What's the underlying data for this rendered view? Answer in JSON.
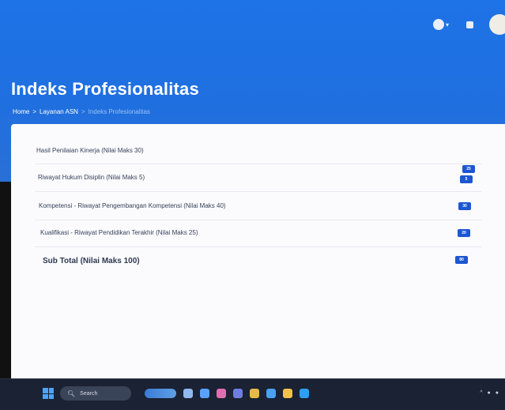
{
  "header": {
    "title": "Indeks Profesionalitas",
    "breadcrumb": {
      "home": "Home",
      "sep1": ">",
      "section": "Layanan ASN",
      "sep2": ">",
      "current": "Indeks Profesionalitas"
    }
  },
  "topbar": {
    "icons": [
      "user-menu-icon",
      "notification-icon",
      "avatar"
    ]
  },
  "rows": [
    {
      "label": "Hasil Penilaian Kinerja (Nilai Maks 30)",
      "value": "25"
    },
    {
      "label": "Riwayat Hukum Disiplin (Nilai Maks 5)",
      "value": "5"
    },
    {
      "label": "Kompetensi - Riwayat Pengembangan Kompetensi (Nilai Maks 40)",
      "value": "30"
    },
    {
      "label": "Kualifikasi - Riwayat Pendidikan Terakhir (Nilai Maks 25)",
      "value": "20"
    }
  ],
  "total": {
    "label": "Sub Total (Nilai Maks 100)",
    "value": "80"
  },
  "taskbar": {
    "search_label": "Search"
  },
  "colors": {
    "primary": "#1e73e6",
    "badge": "#1c56d3",
    "card": "#fbfbfd",
    "taskbar": "#1a2233"
  }
}
